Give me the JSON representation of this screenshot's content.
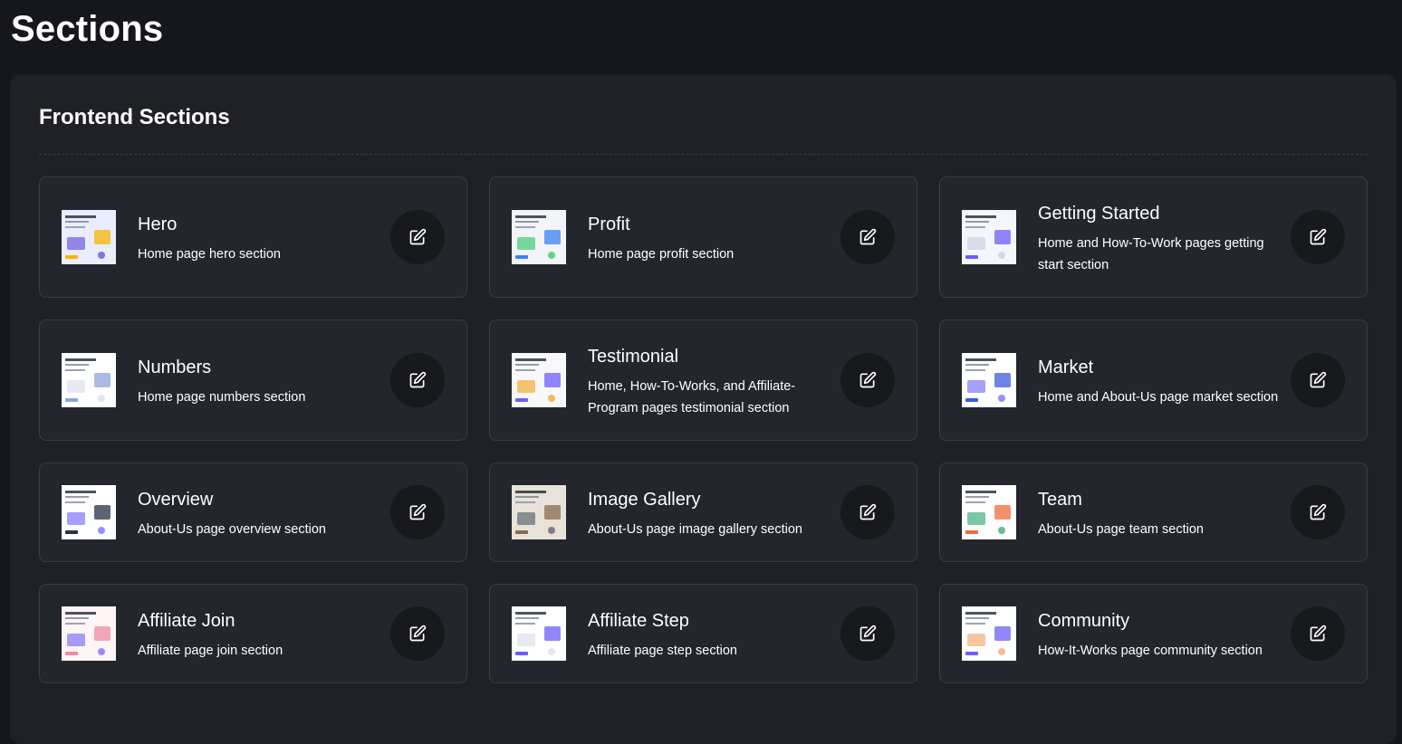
{
  "page": {
    "title": "Sections"
  },
  "panel": {
    "title": "Frontend Sections"
  },
  "sections": [
    {
      "title": "Hero",
      "description": "Home page hero section",
      "thumb": "hero-thumbnail"
    },
    {
      "title": "Profit",
      "description": "Home page profit section",
      "thumb": "profit-thumbnail"
    },
    {
      "title": "Getting Started",
      "description": "Home and How-To-Work pages getting start section",
      "thumb": "getting-started-thumbnail"
    },
    {
      "title": "Numbers",
      "description": "Home page numbers section",
      "thumb": "numbers-thumbnail"
    },
    {
      "title": "Testimonial",
      "description": "Home, How-To-Works, and Affiliate-Program pages testimonial section",
      "thumb": "testimonial-thumbnail"
    },
    {
      "title": "Market",
      "description": "Home and About-Us page market section",
      "thumb": "market-thumbnail"
    },
    {
      "title": "Overview",
      "description": "About-Us page overview section",
      "thumb": "overview-thumbnail"
    },
    {
      "title": "Image Gallery",
      "description": "About-Us page image gallery section",
      "thumb": "image-gallery-thumbnail"
    },
    {
      "title": "Team",
      "description": "About-Us page team section",
      "thumb": "team-thumbnail"
    },
    {
      "title": "Affiliate Join",
      "description": "Affiliate page join section",
      "thumb": "affiliate-join-thumbnail"
    },
    {
      "title": "Affiliate Step",
      "description": "Affiliate page step section",
      "thumb": "affiliate-step-thumbnail"
    },
    {
      "title": "Community",
      "description": "How-It-Works page community section",
      "thumb": "community-thumbnail"
    }
  ],
  "icons": {
    "edit": "edit-icon"
  },
  "colors": {
    "background": "#15171c",
    "panel": "#1f2127",
    "card": "#23262d",
    "card_border": "#3a3d45",
    "button": "#17191d"
  }
}
